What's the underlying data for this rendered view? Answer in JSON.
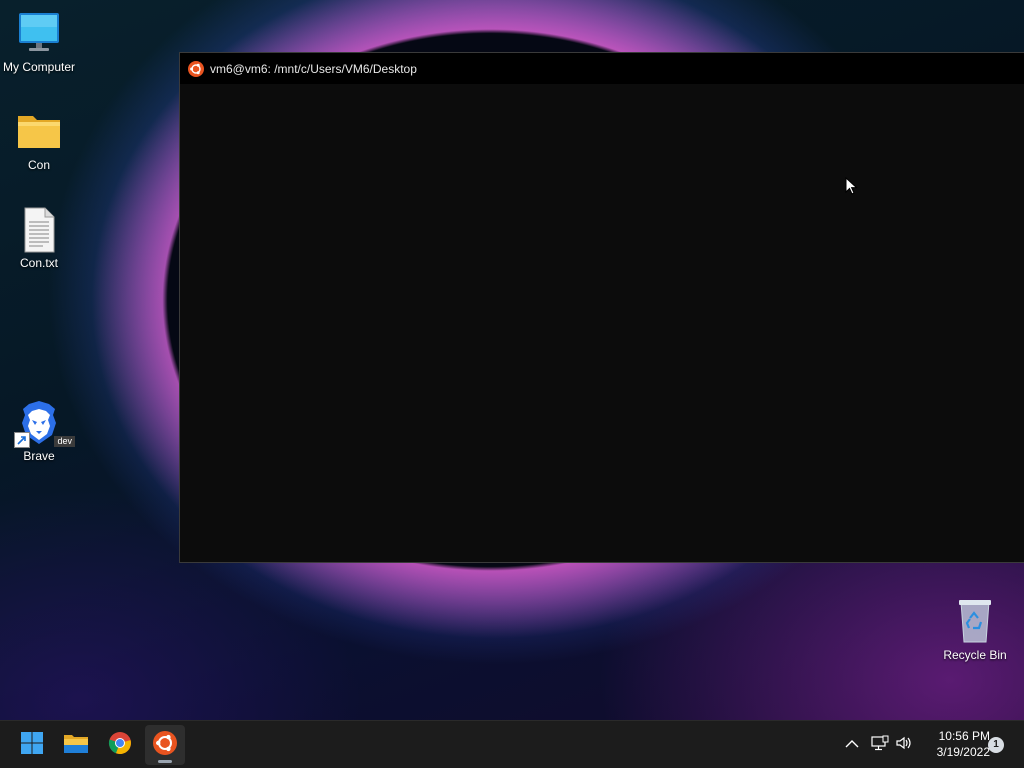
{
  "desktop": {
    "icons": [
      {
        "label": "My Computer"
      },
      {
        "label": "Con"
      },
      {
        "label": "Con.txt"
      },
      {
        "label": "Brave"
      },
      {
        "label": "Recycle Bin"
      }
    ],
    "brave_badge": "dev"
  },
  "terminal": {
    "title": "vm6@vm6: /mnt/c/Users/VM6/Desktop",
    "icon": "ubuntu-icon",
    "background": "#0c0c0c"
  },
  "taskbar": {
    "apps": [
      {
        "icon": "windows-start-icon"
      },
      {
        "icon": "file-explorer-icon"
      },
      {
        "icon": "chrome-icon"
      },
      {
        "icon": "ubuntu-icon",
        "active": true
      }
    ],
    "tray": {
      "chevron_icon": "chevron-up-icon",
      "network_icon": "network-icon",
      "volume_icon": "volume-icon"
    },
    "clock": {
      "time": "10:56 PM",
      "date": "3/19/2022"
    },
    "notification_count": "1"
  },
  "colors": {
    "ubuntu_orange": "#e95420",
    "taskbar": "#1c1c1c",
    "folder_yellow": "#f6c648"
  }
}
